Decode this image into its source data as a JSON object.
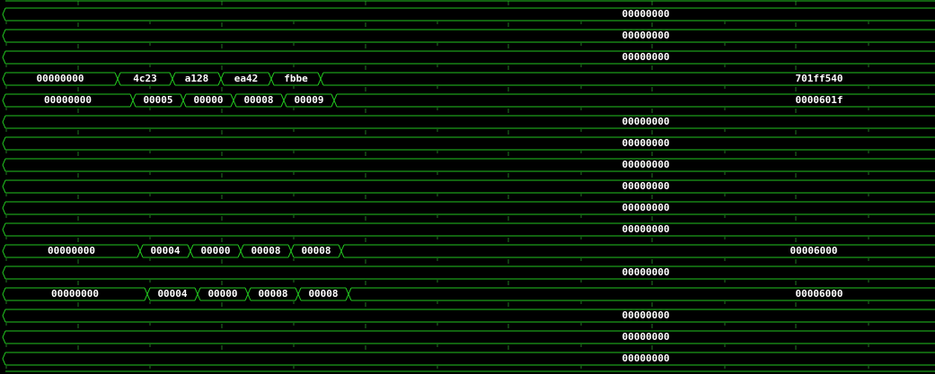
{
  "rows": [
    {
      "segments": [
        {
          "value": "00000000"
        }
      ]
    },
    {
      "segments": [
        {
          "value": "00000000"
        }
      ]
    },
    {
      "segments": [
        {
          "value": "00000000"
        }
      ]
    },
    {
      "segments": [
        {
          "value": "00000000"
        },
        {
          "value": "4c23"
        },
        {
          "value": "a128"
        },
        {
          "value": "ea42"
        },
        {
          "value": "fbbe"
        },
        {
          "value": "701ff540"
        }
      ]
    },
    {
      "segments": [
        {
          "value": "00000000"
        },
        {
          "value": "00005"
        },
        {
          "value": "00000"
        },
        {
          "value": "00008"
        },
        {
          "value": "00009"
        },
        {
          "value": "0000601f"
        }
      ]
    },
    {
      "segments": [
        {
          "value": "00000000"
        }
      ]
    },
    {
      "segments": [
        {
          "value": "00000000"
        }
      ]
    },
    {
      "segments": [
        {
          "value": "00000000"
        }
      ]
    },
    {
      "segments": [
        {
          "value": "00000000"
        }
      ]
    },
    {
      "segments": [
        {
          "value": "00000000"
        }
      ]
    },
    {
      "segments": [
        {
          "value": "00000000"
        }
      ]
    },
    {
      "segments": [
        {
          "value": "00000000"
        },
        {
          "value": "00004"
        },
        {
          "value": "00000"
        },
        {
          "value": "00008"
        },
        {
          "value": "00008"
        },
        {
          "value": "00006000"
        }
      ]
    },
    {
      "segments": [
        {
          "value": "00000000"
        }
      ]
    },
    {
      "segments": [
        {
          "value": "00000000"
        },
        {
          "value": "00004"
        },
        {
          "value": "00000"
        },
        {
          "value": "00008"
        },
        {
          "value": "00008"
        },
        {
          "value": "00006000"
        }
      ]
    },
    {
      "segments": [
        {
          "value": "00000000"
        }
      ]
    },
    {
      "segments": [
        {
          "value": "00000000"
        }
      ]
    },
    {
      "segments": [
        {
          "value": "00000000"
        }
      ]
    }
  ],
  "colors": {
    "background": "#000000",
    "trace": "#22c41f",
    "grid": "#1f7a1f",
    "text": "#ffffff"
  }
}
